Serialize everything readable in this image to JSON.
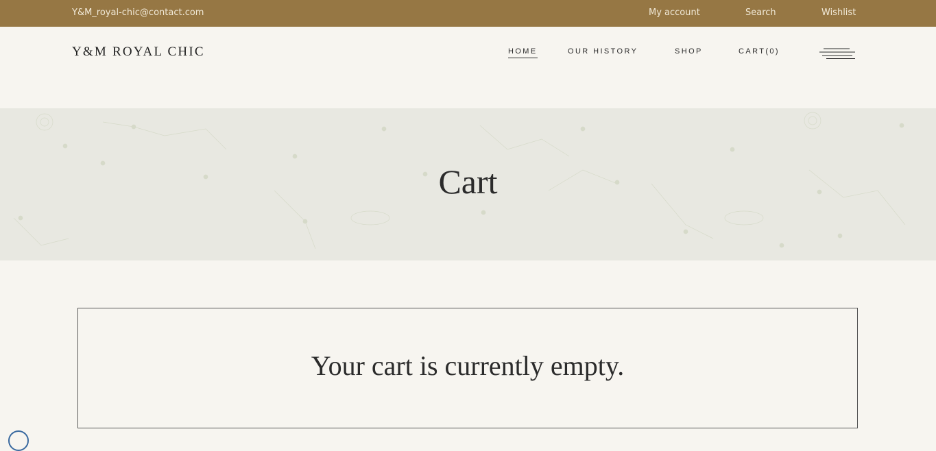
{
  "topbar": {
    "email": "Y&M_royal-chic@contact.com",
    "links": [
      "My account",
      "Search",
      "Wishlist"
    ]
  },
  "header": {
    "logo": "Y&M ROYAL CHIC",
    "nav": [
      "HOME",
      "OUR HISTORY",
      "SHOP",
      "CART(0)"
    ],
    "menu_icon": "hamburger-menu-icon"
  },
  "banner": {
    "title": "Cart"
  },
  "cart": {
    "empty_message": "Your cart is currently empty."
  },
  "colors": {
    "topbar_bg": "#967744",
    "page_bg": "#f7f5f0",
    "banner_bg": "#e8e8e1",
    "text": "#2b2b2b"
  },
  "accessibility_icon": "accessibility-icon"
}
